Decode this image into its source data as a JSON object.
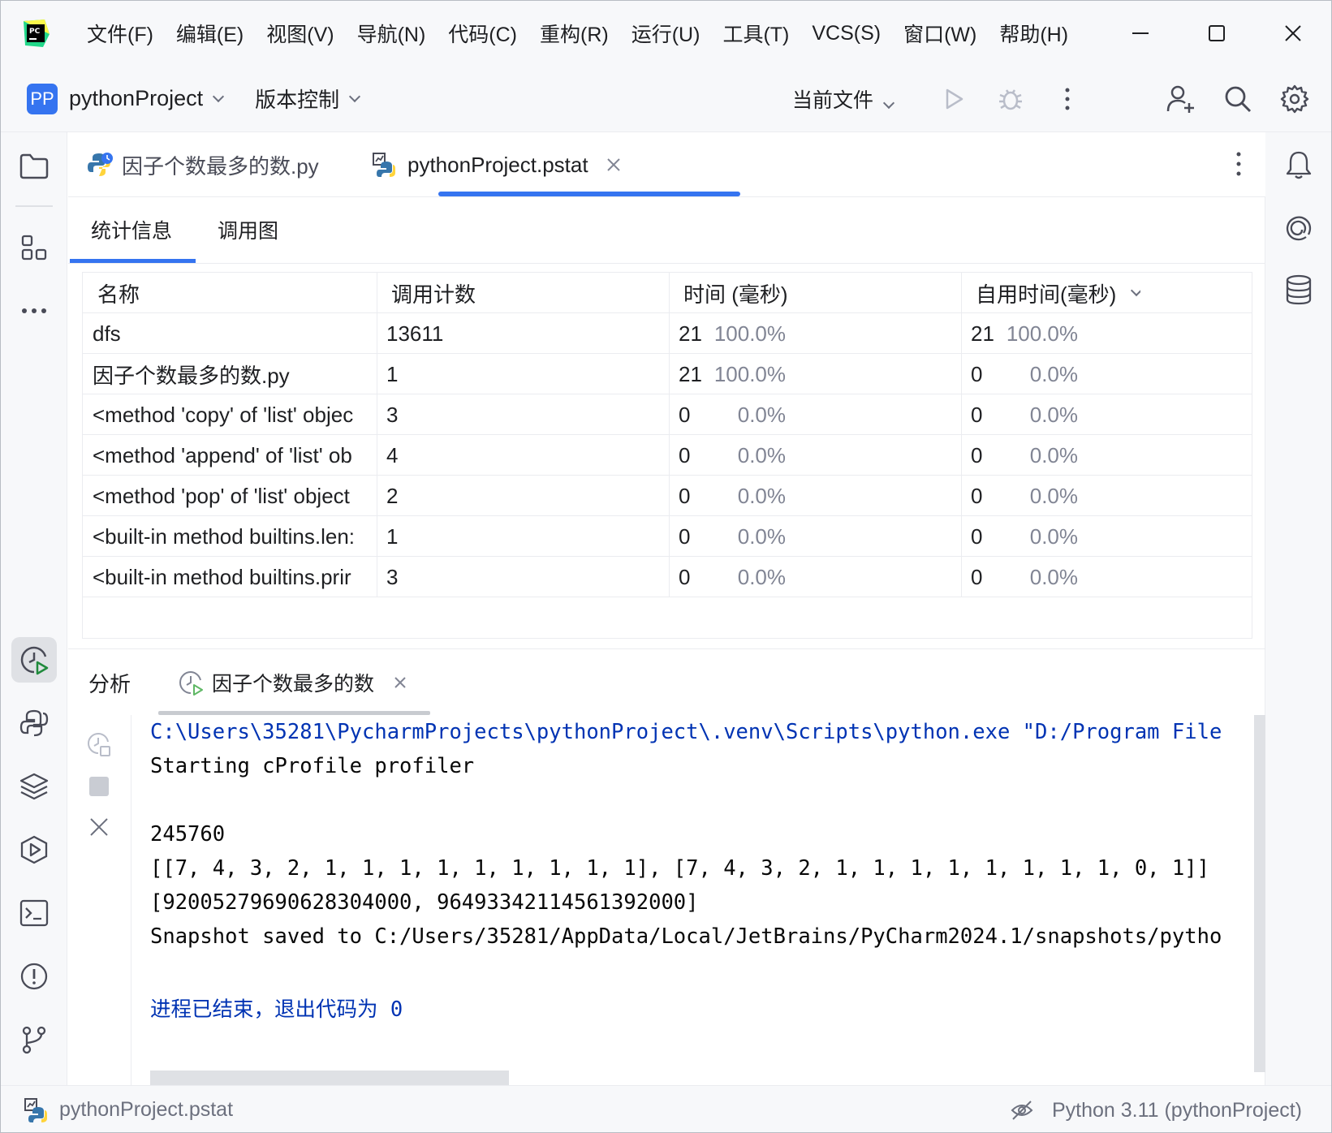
{
  "menubar": {
    "items": [
      "文件(F)",
      "编辑(E)",
      "视图(V)",
      "导航(N)",
      "代码(C)",
      "重构(R)",
      "运行(U)",
      "工具(T)",
      "VCS(S)",
      "窗口(W)",
      "帮助(H)"
    ],
    "logo_text": "PC"
  },
  "toolbar": {
    "project_badge": "PP",
    "project_name": "pythonProject",
    "vcs_label": "版本控制",
    "run_config": "当前文件"
  },
  "editor_tabs": [
    {
      "label": "因子个数最多的数.py",
      "active": false
    },
    {
      "label": "pythonProject.pstat",
      "active": true
    }
  ],
  "sub_tabs": [
    "统计信息",
    "调用图"
  ],
  "table": {
    "headers": [
      "名称",
      "调用计数",
      "时间 (毫秒)",
      "自用时间(毫秒)"
    ],
    "rows": [
      {
        "name": "dfs",
        "calls": "13611",
        "time": "21",
        "time_pct": "100.0%",
        "own": "21",
        "own_pct": "100.0%"
      },
      {
        "name": "因子个数最多的数.py",
        "calls": "1",
        "time": "21",
        "time_pct": "100.0%",
        "own": "0",
        "own_pct": "0.0%"
      },
      {
        "name": "<method 'copy' of 'list' objec",
        "calls": "3",
        "time": "0",
        "time_pct": "0.0%",
        "own": "0",
        "own_pct": "0.0%"
      },
      {
        "name": "<method 'append' of 'list' ob",
        "calls": "4",
        "time": "0",
        "time_pct": "0.0%",
        "own": "0",
        "own_pct": "0.0%"
      },
      {
        "name": "<method 'pop' of 'list' object",
        "calls": "2",
        "time": "0",
        "time_pct": "0.0%",
        "own": "0",
        "own_pct": "0.0%"
      },
      {
        "name": "<built-in method builtins.len:",
        "calls": "1",
        "time": "0",
        "time_pct": "0.0%",
        "own": "0",
        "own_pct": "0.0%"
      },
      {
        "name": "<built-in method builtins.prir",
        "calls": "3",
        "time": "0",
        "time_pct": "0.0%",
        "own": "0",
        "own_pct": "0.0%"
      }
    ]
  },
  "tool_window": {
    "title": "分析",
    "tab_label": "因子个数最多的数"
  },
  "console": {
    "lines": [
      "C:\\Users\\35281\\PycharmProjects\\pythonProject\\.venv\\Scripts\\python.exe \"D:/Program File",
      "Starting cProfile profiler",
      "",
      "245760",
      "[[7, 4, 3, 2, 1, 1, 1, 1, 1, 1, 1, 1, 1], [7, 4, 3, 2, 1, 1, 1, 1, 1, 1, 1, 1, 0, 1]]",
      "[92005279690628304000, 96493342114561392000]",
      "Snapshot saved to C:/Users/35281/AppData/Local/JetBrains/PyCharm2024.1/snapshots/pytho",
      "",
      "进程已结束，退出代码为 0"
    ]
  },
  "statusbar": {
    "file": "pythonProject.pstat",
    "interpreter": "Python 3.11 (pythonProject)"
  },
  "colors": {
    "accent": "#3574f0",
    "console_blue": "#0033b3",
    "muted": "#818594"
  }
}
